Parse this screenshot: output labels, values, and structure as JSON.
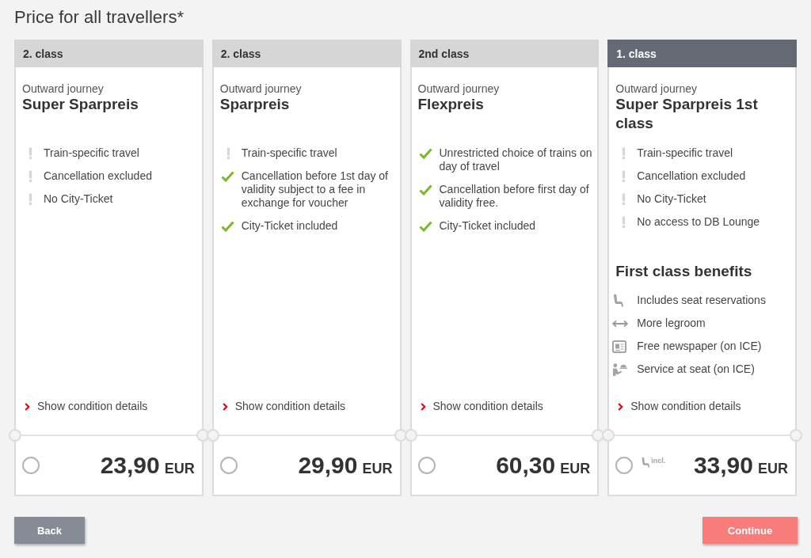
{
  "title": "Price for all travellers*",
  "offers": [
    {
      "kind": "standard",
      "class_label": "2. class",
      "journey": "Outward journey",
      "name": "Super Sparpreis",
      "conditions": [
        {
          "kind": "restriction",
          "text": "Train-specific travel"
        },
        {
          "kind": "restriction",
          "text": "Cancellation excluded"
        },
        {
          "kind": "restriction",
          "text": "No City-Ticket"
        }
      ],
      "details_link": "Show condition details",
      "selected": false,
      "price": "23,90",
      "currency": "EUR"
    },
    {
      "kind": "standard",
      "class_label": "2. class",
      "journey": "Outward journey",
      "name": "Sparpreis",
      "conditions": [
        {
          "kind": "restriction",
          "text": "Train-specific travel"
        },
        {
          "kind": "included",
          "text": "Cancellation before 1st day of validity subject to a fee in exchange for voucher"
        },
        {
          "kind": "included",
          "text": "City-Ticket included"
        }
      ],
      "details_link": "Show condition details",
      "selected": false,
      "price": "29,90",
      "currency": "EUR"
    },
    {
      "kind": "standard",
      "class_label": "2nd class",
      "journey": "Outward journey",
      "name": "Flexpreis",
      "conditions": [
        {
          "kind": "included",
          "text": "Unrestricted choice of trains on day of travel"
        },
        {
          "kind": "included",
          "text": "Cancellation before first day of validity free."
        },
        {
          "kind": "included",
          "text": "City-Ticket included"
        }
      ],
      "details_link": "Show condition details",
      "selected": false,
      "price": "60,30",
      "currency": "EUR"
    },
    {
      "kind": "first_class",
      "class_label": "1. class",
      "journey": "Outward journey",
      "name": "Super Sparpreis 1st class",
      "conditions": [
        {
          "kind": "restriction",
          "text": "Train-specific travel"
        },
        {
          "kind": "restriction",
          "text": "Cancellation excluded"
        },
        {
          "kind": "restriction",
          "text": "No City-Ticket"
        },
        {
          "kind": "restriction",
          "text": "No access to DB Lounge"
        }
      ],
      "benefits": {
        "title": "First class benefits",
        "items": [
          {
            "kind": "seat",
            "text": "Includes seat reservations"
          },
          {
            "kind": "legroom",
            "text": "More legroom"
          },
          {
            "kind": "newspaper",
            "text": "Free newspaper (on ICE)"
          },
          {
            "kind": "service",
            "text": "Service at seat (on ICE)"
          }
        ]
      },
      "details_link": "Show condition details",
      "selected": false,
      "price_note": {
        "kind": "seat",
        "text": "incl."
      },
      "price": "33,90",
      "currency": "EUR"
    }
  ],
  "actions": {
    "back": "Back",
    "continue": "Continue"
  }
}
